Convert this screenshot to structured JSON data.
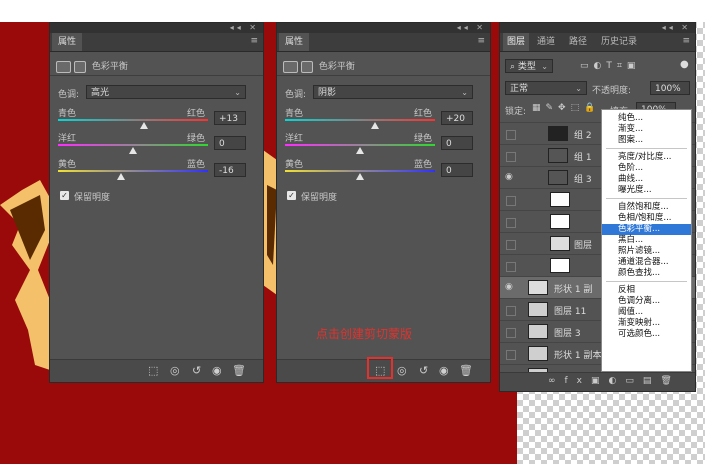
{
  "colors": {
    "canvas_red": "#9a0a0a",
    "panel_bg": "#535353",
    "highlight": "#2f78d7",
    "annotation": "#e3322d"
  },
  "panel_left": {
    "tab_title": "属性",
    "adjust_title": "色彩平衡",
    "tone_label": "色调:",
    "tone_value": "高光",
    "sliders": [
      {
        "left": "青色",
        "right": "红色",
        "value": "+13",
        "level": 0.57
      },
      {
        "left": "洋红",
        "right": "绿色",
        "value": "0",
        "level": 0.5
      },
      {
        "left": "黄色",
        "right": "蓝色",
        "value": "-16",
        "level": 0.42
      }
    ],
    "preserve_label": "保留明度"
  },
  "panel_mid": {
    "tab_title": "属性",
    "adjust_title": "色彩平衡",
    "tone_label": "色调:",
    "tone_value": "阴影",
    "sliders": [
      {
        "left": "青色",
        "right": "红色",
        "value": "+20",
        "level": 0.6
      },
      {
        "left": "洋红",
        "right": "绿色",
        "value": "0",
        "level": 0.5
      },
      {
        "left": "黄色",
        "right": "蓝色",
        "value": "0",
        "level": 0.5
      }
    ],
    "preserve_label": "保留明度",
    "annotation": "点击创建剪切蒙版"
  },
  "layers_panel": {
    "tabs": [
      "图层",
      "通道",
      "路径",
      "历史记录"
    ],
    "filter": "类型",
    "blend_mode": "正常",
    "opacity_label": "不透明度:",
    "opacity_value": "100%",
    "lock_label": "锁定:",
    "fill_label": "填充:",
    "fill_value": "100%",
    "layers": [
      {
        "name": "组 2",
        "visible": false
      },
      {
        "name": "组 1",
        "visible": false
      },
      {
        "name": "组 3",
        "visible": true
      },
      {
        "name": "",
        "visible": false
      },
      {
        "name": "",
        "visible": false
      },
      {
        "name": "图层",
        "visible": false
      },
      {
        "name": "",
        "visible": false
      },
      {
        "name": "形状 1 副",
        "visible": true
      },
      {
        "name": "图层 11",
        "visible": false
      },
      {
        "name": "图层 3",
        "visible": false
      },
      {
        "name": "形状 1 副本",
        "visible": false
      },
      {
        "name": "形状 1 副本",
        "visible": false
      }
    ]
  },
  "context_menu": {
    "groups": [
      [
        "纯色...",
        "渐变...",
        "图案..."
      ],
      [
        "亮度/对比度...",
        "色阶...",
        "曲线...",
        "曝光度..."
      ],
      [
        "自然饱和度...",
        "色相/饱和度...",
        "色彩平衡...",
        "黑白...",
        "照片滤镜...",
        "通道混合器...",
        "颜色查找..."
      ],
      [
        "反相",
        "色调分离...",
        "阈值...",
        "渐变映射...",
        "可选颜色..."
      ]
    ],
    "highlighted": "色彩平衡..."
  }
}
